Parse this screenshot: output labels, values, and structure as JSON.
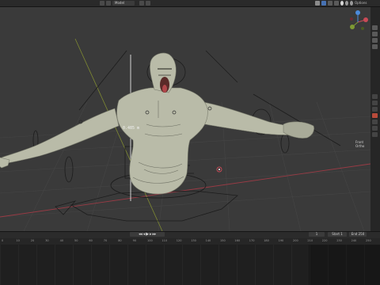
{
  "header": {
    "mode_value": "Model",
    "options_label": "Options"
  },
  "viewport": {
    "measure_value": "0.485 m",
    "view_label": "Front Ortho"
  },
  "timeline": {
    "play_controls": "◂◂ ◂ ▶ ▸ ▸▸",
    "current_frame": "1",
    "start_label": "Start 1",
    "end_label": "End 250",
    "ticks": [
      "0",
      "10",
      "20",
      "30",
      "40",
      "50",
      "60",
      "70",
      "80",
      "90",
      "100",
      "110",
      "120",
      "130",
      "140",
      "150",
      "160",
      "170",
      "180",
      "190",
      "200",
      "210",
      "220",
      "230",
      "240",
      "250"
    ]
  },
  "colors": {
    "viewport_bg": "#3a3a3a",
    "mesh": "#b9bba8",
    "axis_x": "#9a3b45",
    "axis_y": "#7f8a32"
  }
}
